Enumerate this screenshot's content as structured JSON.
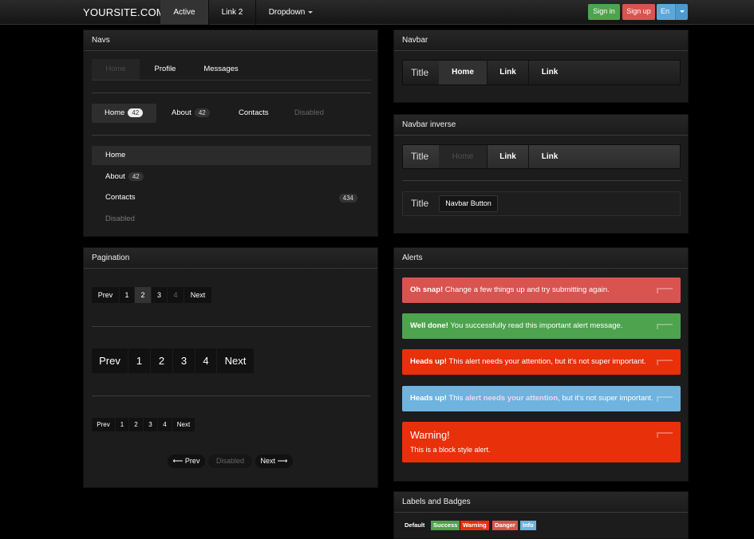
{
  "topbar": {
    "brand": "YOURSITE.COM",
    "nav": [
      "Active",
      "Link 2",
      "Dropdown"
    ],
    "signin": "Sign in",
    "signup": "Sign up",
    "lang": "En"
  },
  "navs": {
    "title": "Navs",
    "tabs": [
      "Home",
      "Profile",
      "Messages"
    ],
    "pills": {
      "home": "Home",
      "home_badge": "42",
      "about": "About",
      "about_badge": "42",
      "contacts": "Contacts",
      "disabled": "Disabled"
    },
    "stacked": {
      "home": "Home",
      "about": "About",
      "about_badge": "42",
      "contacts": "Contacts",
      "contacts_badge": "434",
      "disabled": "Disabled"
    }
  },
  "pagination": {
    "title": "Pagination",
    "small": [
      "Prev",
      "1",
      "2",
      "3",
      "4",
      "Next"
    ],
    "large": [
      "Prev",
      "1",
      "2",
      "3",
      "4",
      "Next"
    ],
    "mini": [
      "Prev",
      "1",
      "2",
      "3",
      "4",
      "Next"
    ],
    "pager": {
      "prev": "⟵ Prev",
      "disabled": "Disabled",
      "next": "Next ⟶"
    }
  },
  "navbar": {
    "title": "Navbar",
    "brand": "Title",
    "links": [
      "Home",
      "Link",
      "Link"
    ]
  },
  "navbar_inverse": {
    "title": "Navbar inverse",
    "brand": "Title",
    "links": [
      "Home",
      "Link",
      "Link"
    ],
    "brand2": "Title",
    "button": "Navbar Button"
  },
  "alerts": {
    "title": "Alerts",
    "error": {
      "strong": "Oh snap!",
      "text": " Change a few things up and try submitting again."
    },
    "success": {
      "strong": "Well done!",
      "text": " You successfully read this important alert message."
    },
    "warning": {
      "strong": "Heads up!",
      "text": " This alert needs your attention, but it's not super important."
    },
    "info": {
      "strong": "Heads up!",
      "text1": " This ",
      "link": "alert needs your attention",
      "text2": ", but it's not super important."
    },
    "block": {
      "heading": "Warning!",
      "text": "This is a block style alert."
    }
  },
  "labels": {
    "title": "Labels and Badges",
    "items": [
      "Default",
      "Success",
      "Warning",
      "Danger",
      "Info"
    ]
  },
  "colors": {
    "green": "#4ea34e",
    "red": "#d9534f",
    "orange": "#e8300b",
    "blue": "#6fb3e0"
  }
}
